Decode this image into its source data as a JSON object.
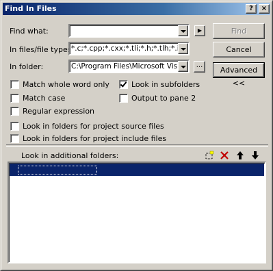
{
  "window": {
    "title": "Find In Files",
    "help_label": "?",
    "close_label": "×"
  },
  "find_what": {
    "label": "Find what:",
    "value": ""
  },
  "file_types": {
    "label": "In files/file types:",
    "value": "*.c;*.cpp;*.cxx;*.tli;*.h;*.tlh;*.inl;*.rc"
  },
  "folder": {
    "label": "In folder:",
    "value": "C:\\Program Files\\Microsoft Visual Studio",
    "browse_label": "..."
  },
  "buttons": {
    "find": "Find",
    "cancel": "Cancel",
    "advanced": "Advanced <<",
    "menu_arrow": "▶"
  },
  "options": {
    "match_whole_word": {
      "label": "Match whole word only",
      "checked": false
    },
    "match_case": {
      "label": "Match case",
      "checked": false
    },
    "regular_expression": {
      "label": "Regular expression",
      "checked": false
    },
    "project_source": {
      "label": "Look in folders for project source files",
      "checked": false
    },
    "project_include": {
      "label": "Look in folders for project include files",
      "checked": false
    },
    "look_in_subfolders": {
      "label": "Look in subfolders",
      "checked": true
    },
    "output_pane2": {
      "label": "Output to pane 2",
      "checked": false
    }
  },
  "additional_folders": {
    "label": "Look in additional folders:",
    "items": [
      ""
    ]
  },
  "colors": {
    "face": "#d4d0c8",
    "title_start": "#0a246a",
    "title_end": "#a6caf0",
    "selection": "#0a246a"
  }
}
